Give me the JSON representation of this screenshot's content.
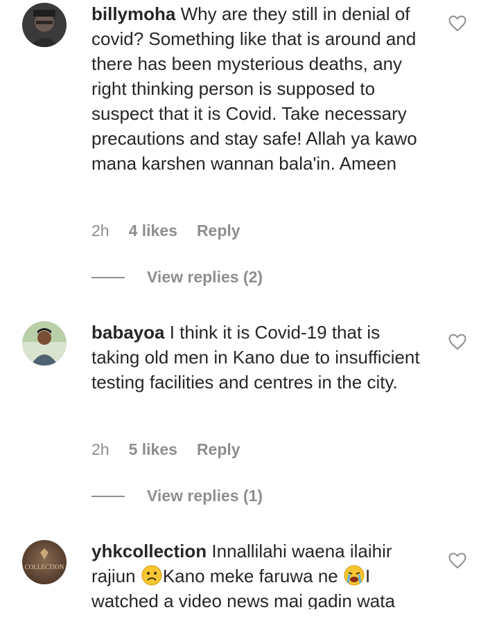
{
  "comments": [
    {
      "username": "billymoha",
      "text": "Why are they still in denial of covid? Something like that is around and there has been mysterious deaths, any right thinking person is supposed to suspect that it is Covid. Take necessary precautions and stay safe! Allah ya kawo mana karshen wannan bala'in. Ameen",
      "time": "2h",
      "likes": "4 likes",
      "reply": "Reply",
      "view_replies": "View replies (2)"
    },
    {
      "username": "babayoa",
      "text": "I think it is Covid-19 that is taking old men in Kano due to insufficient testing facilities and centres in the city.",
      "time": "2h",
      "likes": "5 likes",
      "reply": "Reply",
      "view_replies": "View replies (1)"
    },
    {
      "username": "yhkcollection",
      "text_part1": "Innallilahi waena ilaihir rajiun",
      "emoji1": "frowning-face-icon",
      "text_part2": "Kano meke faruwa ne",
      "emoji2": "crying-face-icon",
      "text_part3": "I watched a video news mai gadin wata",
      "avatar_logo_text": "COLLECTION"
    }
  ],
  "colors": {
    "primary_text": "#262626",
    "secondary_text": "#8e8e8e",
    "background": "#ffffff"
  }
}
